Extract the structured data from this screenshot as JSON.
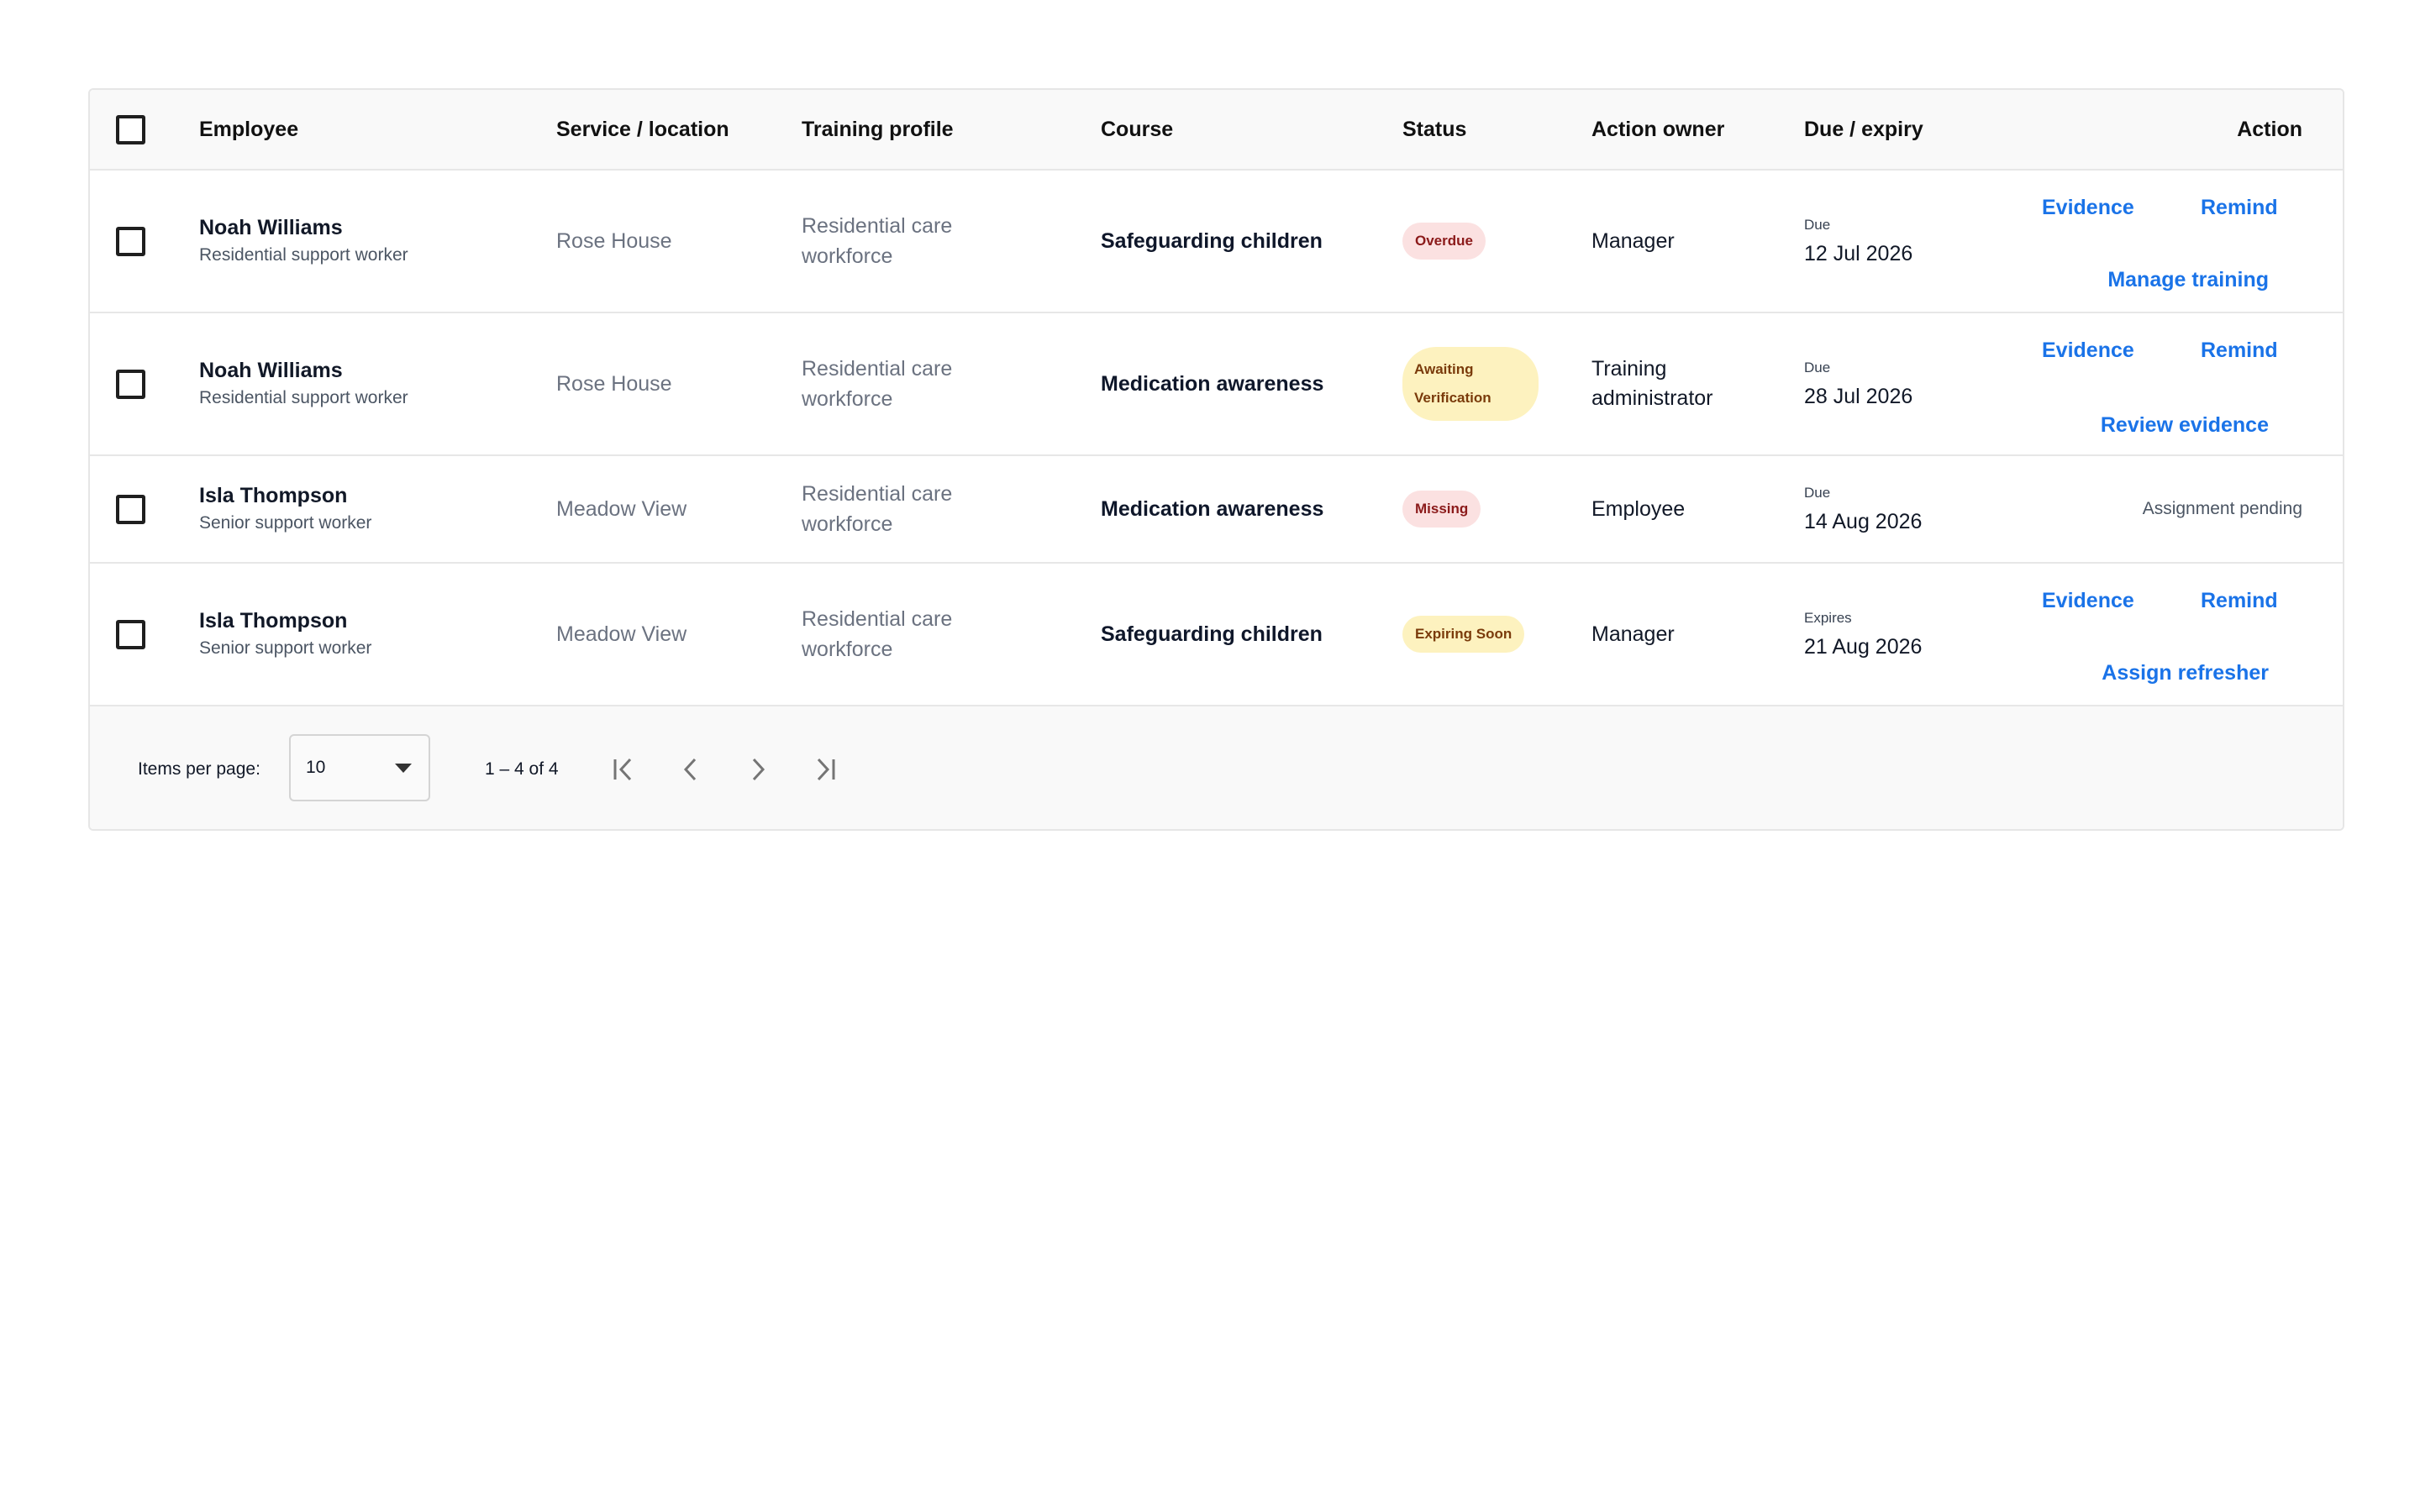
{
  "table": {
    "headers": {
      "employee": "Employee",
      "service": "Service / location",
      "profile": "Training profile",
      "course": "Course",
      "status": "Status",
      "owner": "Action owner",
      "due": "Due / expiry",
      "action": "Action"
    },
    "rows": [
      {
        "name": "Noah Williams",
        "role": "Residential support worker",
        "service": "Rose House",
        "profile_line1": "Residential care",
        "profile_line2": "workforce",
        "course": "Safeguarding children",
        "status": "Overdue",
        "owner_line1": "Manager",
        "owner_line2": "",
        "due_label": "Due",
        "due_date": "12 Jul 2026",
        "action_evidence": "Evidence",
        "action_remind": "Remind",
        "action_secondary": "Manage training"
      },
      {
        "name": "Noah Williams",
        "role": "Residential support worker",
        "service": "Rose House",
        "profile_line1": "Residential care",
        "profile_line2": "workforce",
        "course": "Medication awareness",
        "status_line1": "Awaiting",
        "status_line2": "Verification",
        "owner_line1": "Training",
        "owner_line2": "administrator",
        "due_label": "Due",
        "due_date": "28 Jul 2026",
        "action_evidence": "Evidence",
        "action_remind": "Remind",
        "action_secondary": "Review evidence"
      },
      {
        "name": "Isla Thompson",
        "role": "Senior support worker",
        "service": "Meadow View",
        "profile_line1": "Residential care",
        "profile_line2": "workforce",
        "course": "Medication awareness",
        "status": "Missing",
        "owner_line1": "Employee",
        "owner_line2": "",
        "due_label": "Due",
        "due_date": "14 Aug 2026",
        "action_note": "Assignment pending"
      },
      {
        "name": "Isla Thompson",
        "role": "Senior support worker",
        "service": "Meadow View",
        "profile_line1": "Residential care",
        "profile_line2": "workforce",
        "course": "Safeguarding children",
        "status": "Expiring Soon",
        "owner_line1": "Manager",
        "owner_line2": "",
        "due_label": "Expires",
        "due_date": "21 Aug 2026",
        "action_evidence": "Evidence",
        "action_remind": "Remind",
        "action_secondary": "Assign refresher"
      }
    ]
  },
  "pagination": {
    "items_per_page_label": "Items per page:",
    "items_per_page_value": "10",
    "range": "1 – 4 of 4",
    "icons": [
      "first-page-icon",
      "previous-page-icon",
      "next-page-icon",
      "last-page-icon"
    ]
  },
  "colors": {
    "link": "#1a73e8",
    "badge_red_bg": "#fbe1e1",
    "badge_red_text": "#8b1a1a",
    "badge_yellow_bg": "#fdf2bf",
    "badge_yellow_text": "#7a3b0b"
  }
}
